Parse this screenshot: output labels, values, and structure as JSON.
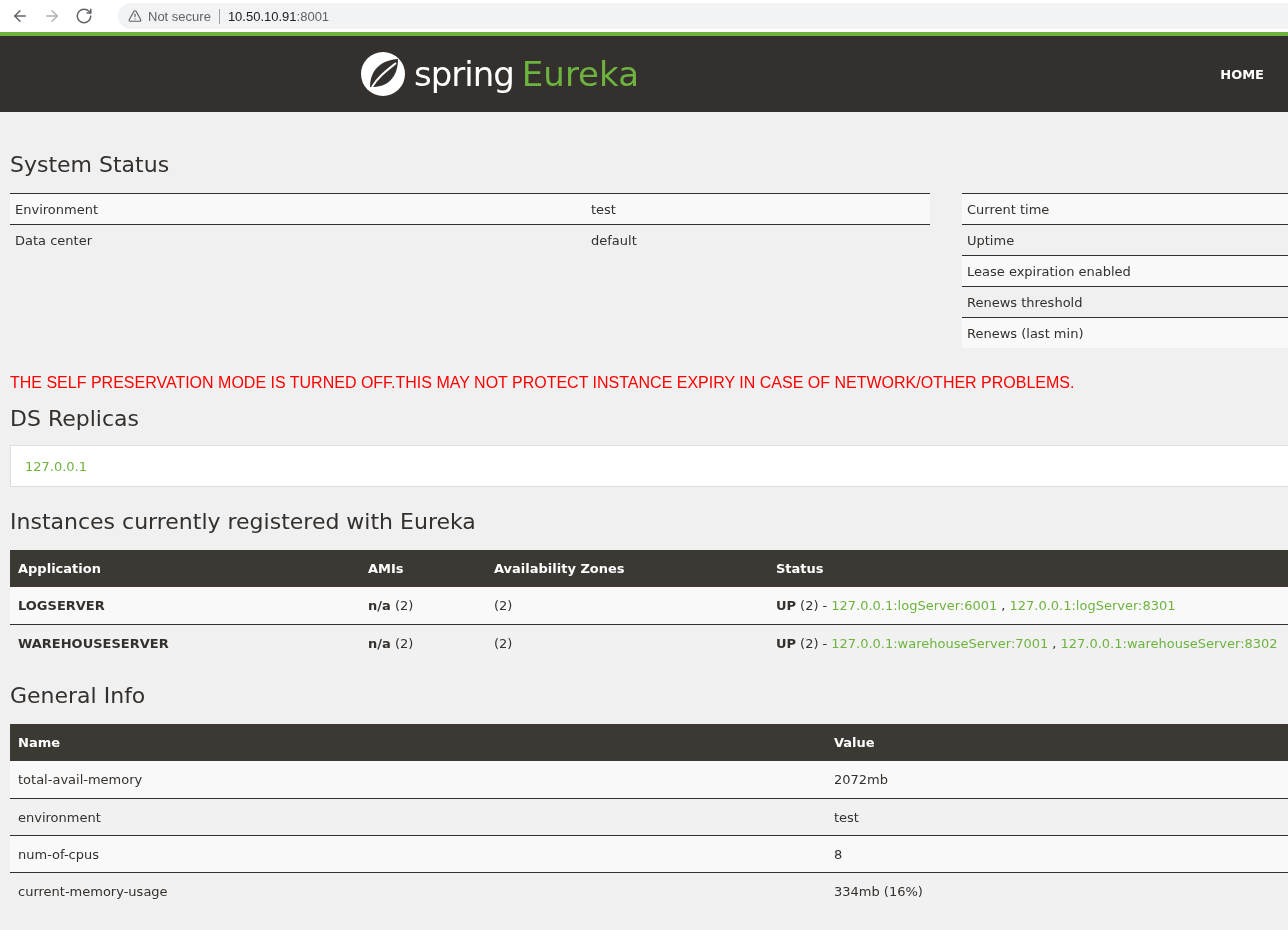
{
  "browser": {
    "nav": [
      {
        "kind": "back",
        "disabled": false
      },
      {
        "kind": "forward",
        "disabled": true
      },
      {
        "kind": "reload",
        "disabled": false
      }
    ],
    "security": "Not secure",
    "host": "10.50.10.91",
    "port": ":8001"
  },
  "header": {
    "brand": "spring",
    "product": "Eureka",
    "nav": [
      {
        "label": "HOME"
      }
    ]
  },
  "system_status": {
    "title": "System Status",
    "left": [
      {
        "name": "Environment",
        "value": "test"
      },
      {
        "name": "Data center",
        "value": "default"
      }
    ],
    "right": [
      {
        "name": "Current time"
      },
      {
        "name": "Uptime"
      },
      {
        "name": "Lease expiration enabled"
      },
      {
        "name": "Renews threshold"
      },
      {
        "name": "Renews (last min)"
      }
    ]
  },
  "warning": "THE SELF PRESERVATION MODE IS TURNED OFF.THIS MAY NOT PROTECT INSTANCE EXPIRY IN CASE OF NETWORK/OTHER PROBLEMS.",
  "replicas": {
    "title": "DS Replicas",
    "items": [
      "127.0.0.1"
    ]
  },
  "instances": {
    "title": "Instances currently registered with Eureka",
    "columns": [
      "Application",
      "AMIs",
      "Availability Zones",
      "Status"
    ],
    "rows": [
      {
        "application": "LOGSERVER",
        "ami": "n/a",
        "ami_count": "(2)",
        "zones": "(2)",
        "state": "UP",
        "count": "(2)",
        "dash": "-",
        "separator": ",",
        "links": [
          "127.0.0.1:logServer:6001",
          "127.0.0.1:logServer:8301"
        ]
      },
      {
        "application": "WAREHOUSESERVER",
        "ami": "n/a",
        "ami_count": "(2)",
        "zones": "(2)",
        "state": "UP",
        "count": "(2)",
        "dash": "-",
        "separator": ",",
        "links": [
          "127.0.0.1:warehouseServer:7001",
          "127.0.0.1:warehouseServer:8302"
        ]
      }
    ]
  },
  "general_info": {
    "title": "General Info",
    "columns": [
      "Name",
      "Value"
    ],
    "rows": [
      {
        "name": "total-avail-memory",
        "value": "2072mb"
      },
      {
        "name": "environment",
        "value": "test"
      },
      {
        "name": "num-of-cpus",
        "value": "8"
      },
      {
        "name": "current-memory-usage",
        "value": "334mb (16%)"
      }
    ]
  }
}
